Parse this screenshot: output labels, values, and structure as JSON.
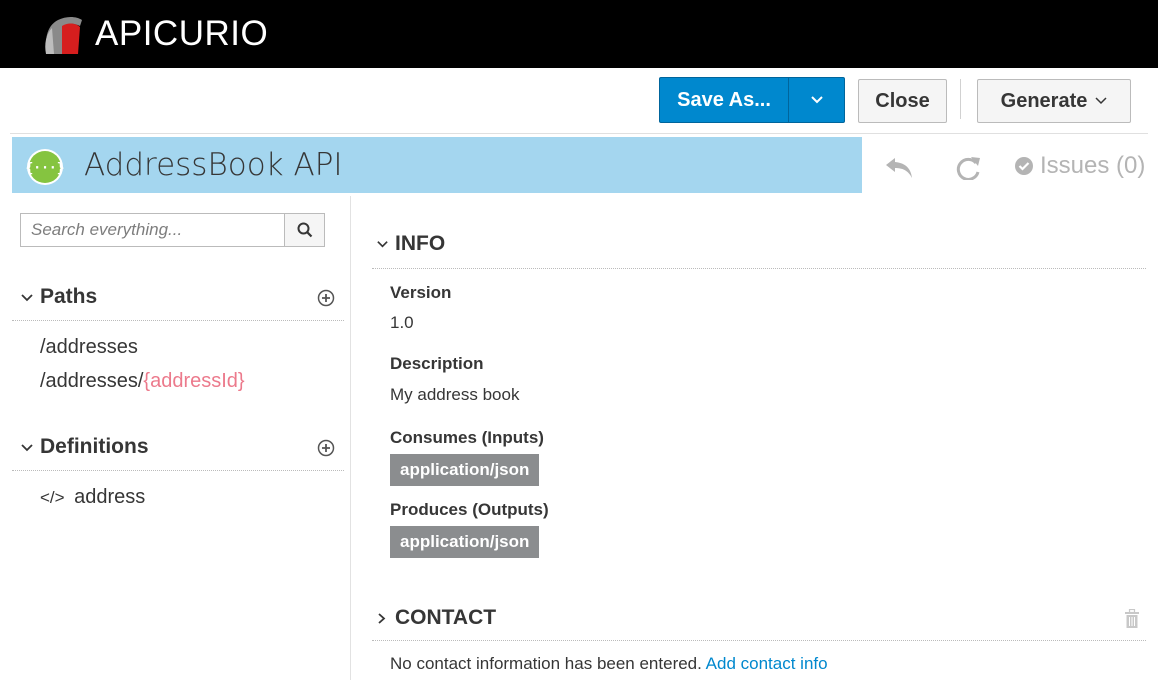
{
  "brand": {
    "name": "APICURIO"
  },
  "toolbar": {
    "save_as_label": "Save As...",
    "close_label": "Close",
    "generate_label": "Generate"
  },
  "title": {
    "api_name": "AddressBook API",
    "issues_label": "Issues (0)"
  },
  "sidebar": {
    "search_placeholder": "Search everything...",
    "paths_title": "Paths",
    "paths": [
      {
        "prefix": "/addresses",
        "param": ""
      },
      {
        "prefix": "/addresses/",
        "param": "{addressId}"
      }
    ],
    "definitions_title": "Definitions",
    "definitions": [
      {
        "code_glyph": "</>",
        "name": "address"
      }
    ]
  },
  "main": {
    "info_title": "INFO",
    "version_label": "Version",
    "version_value": "1.0",
    "description_label": "Description",
    "description_value": "My address book",
    "consumes_label": "Consumes (Inputs)",
    "consumes_value": "application/json",
    "produces_label": "Produces (Outputs)",
    "produces_value": "application/json",
    "contact_title": "CONTACT",
    "contact_message": "No contact information has been entered.",
    "contact_link": "Add contact info"
  },
  "colors": {
    "brand_bar": "#000000",
    "primary": "#0088ce",
    "title_bg": "#a4d6ef",
    "param_text": "#ec7a8c",
    "badge_bg": "#8b8d8f"
  }
}
